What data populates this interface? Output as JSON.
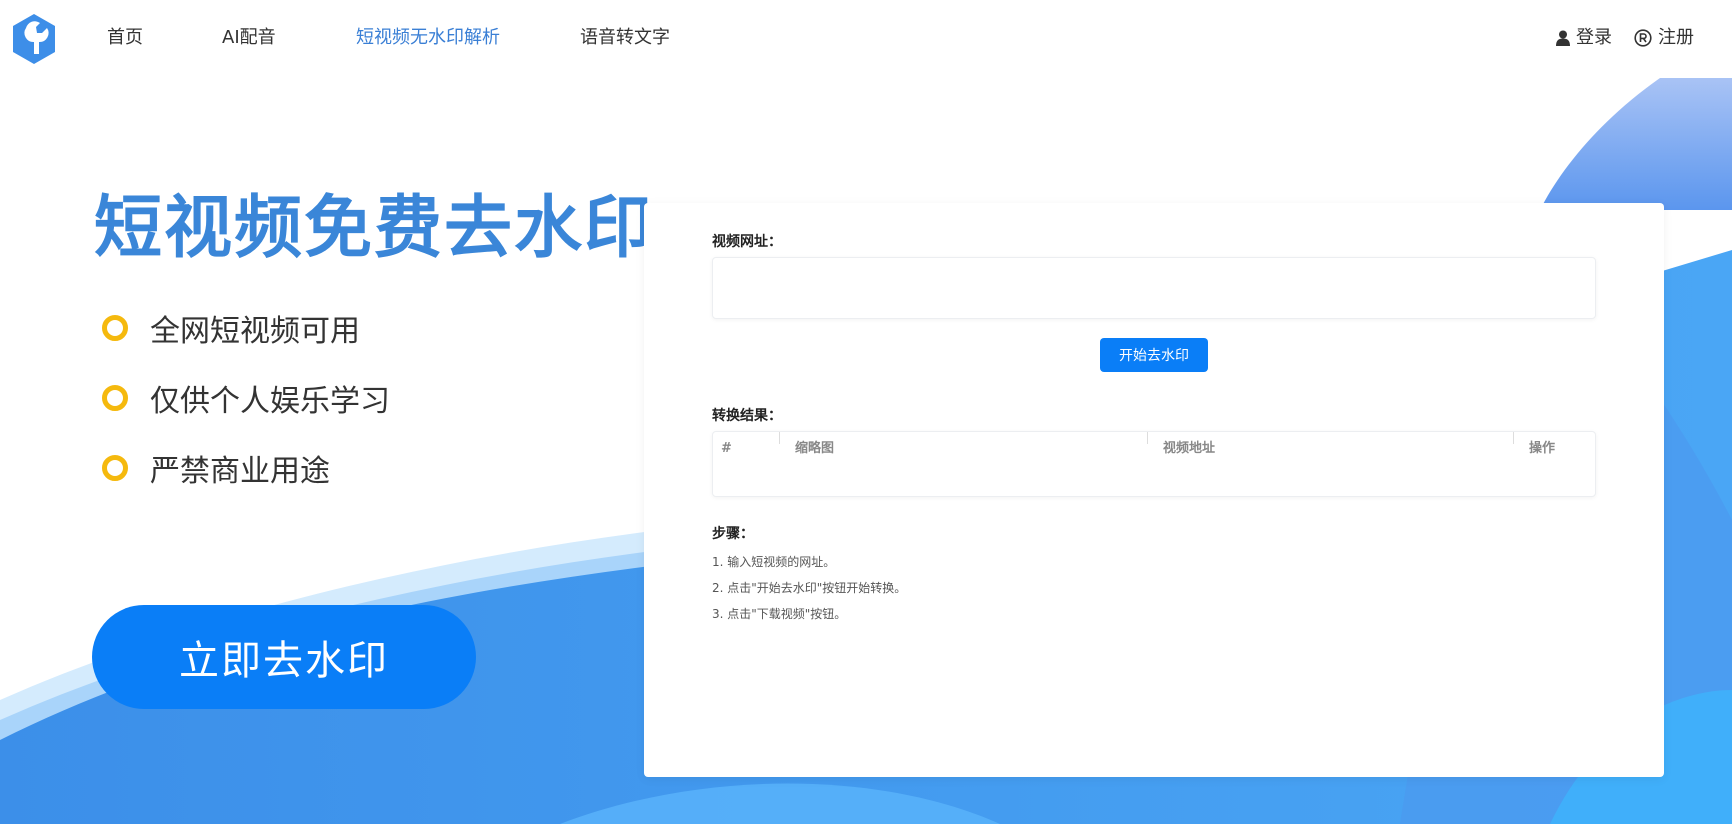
{
  "header": {
    "nav": [
      {
        "label": "首页",
        "active": false
      },
      {
        "label": "AI配音",
        "active": false
      },
      {
        "label": "短视频无水印解析",
        "active": true
      },
      {
        "label": "语音转文字",
        "active": false
      }
    ],
    "login_label": "登录",
    "register_label": "注册",
    "logo_icon": "wrench-hexagon-icon"
  },
  "hero": {
    "title": "短视频免费去水印",
    "features": [
      "全网短视频可用",
      "仅供个人娱乐学习",
      "严禁商业用途"
    ],
    "cta_label": "立即去水印"
  },
  "card": {
    "url_label": "视频网址：",
    "url_value": "",
    "url_placeholder": "",
    "start_label": "开始去水印",
    "result_label": "转换结果：",
    "table_headers": [
      "#",
      "缩略图",
      "视频地址",
      "操作"
    ],
    "steps_label": "步骤：",
    "steps": [
      "1. 输入短视频的网址。",
      "2. 点击\"开始去水印\"按钮开始转换。",
      "3. 点击\"下载视频\"按钮。"
    ]
  },
  "colors": {
    "accent": "#0a7ef7",
    "title": "#3a86d8",
    "active_nav": "#3a7fd5",
    "ring": "#f5b90e",
    "wave_dark": "#3d8ee8",
    "wave_light": "#bfe0fb"
  }
}
